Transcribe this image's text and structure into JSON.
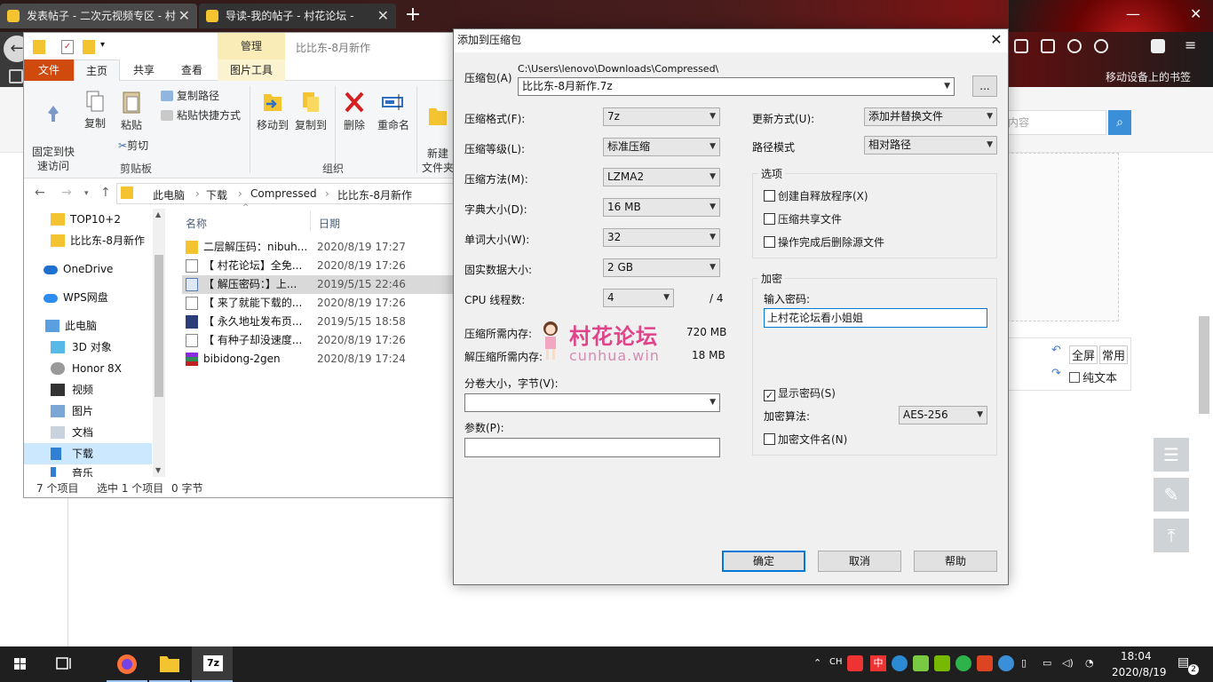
{
  "browser": {
    "tabs": [
      {
        "title": "发表帖子 - 二次元视频专区 - 村"
      },
      {
        "title": "导读-我的帖子 - 村花论坛 -"
      }
    ],
    "bookmarks_label": "移动设备上的书签",
    "search_placeholder": "内容",
    "editor": {
      "fullscreen": "全屏",
      "common": "常用",
      "plain_text": "纯文本"
    }
  },
  "explorer": {
    "title": "比比东-8月新作",
    "manage_tab": "管理",
    "tabs": {
      "file": "文件",
      "home": "主页",
      "share": "共享",
      "view": "查看",
      "picture_tools": "图片工具"
    },
    "ribbon": {
      "pin": "固定到快\n速访问",
      "copy": "复制",
      "paste": "粘贴",
      "copy_path": "复制路径",
      "paste_shortcut": "粘贴快捷方式",
      "cut": "剪切",
      "clipboard": "剪贴板",
      "move_to": "移动到",
      "copy_to": "复制到",
      "delete": "删除",
      "rename": "重命名",
      "new_folder": "新建\n文件夹",
      "organize": "组织"
    },
    "breadcrumb": [
      "此电脑",
      "下载",
      "Compressed",
      "比比东-8月新作"
    ],
    "nav_items": [
      {
        "label": "TOP10+2"
      },
      {
        "label": "比比东-8月新作"
      },
      {
        "label": "OneDrive"
      },
      {
        "label": "WPS网盘"
      },
      {
        "label": "此电脑"
      },
      {
        "label": "3D 对象"
      },
      {
        "label": "Honor 8X"
      },
      {
        "label": "视频"
      },
      {
        "label": "图片"
      },
      {
        "label": "文档"
      },
      {
        "label": "下载"
      },
      {
        "label": "音乐"
      }
    ],
    "columns": {
      "name": "名称",
      "date": "日期"
    },
    "files": [
      {
        "name": "二层解压码：nibuh...",
        "date": "2020/8/19 17:27"
      },
      {
        "name": "【 村花论坛】全免...",
        "date": "2020/8/19 17:26"
      },
      {
        "name": "【 解压密码：】上...",
        "date": "2019/5/15 22:46"
      },
      {
        "name": "【 来了就能下载的...",
        "date": "2020/8/19 17:26"
      },
      {
        "name": "【 永久地址发布页...",
        "date": "2019/5/15 18:58"
      },
      {
        "name": "【 有种子却没速度...",
        "date": "2020/8/19 17:26"
      },
      {
        "name": "bibidong-2gen",
        "date": "2020/8/19 17:24"
      }
    ],
    "status": {
      "count": "7 个项目",
      "selected": "选中 1 个项目",
      "size": "0 字节"
    }
  },
  "dialog": {
    "title": "添加到压缩包",
    "archive_label": "压缩包(A)",
    "archive_path": "C:\\Users\\lenovo\\Downloads\\Compressed\\",
    "archive_name": "比比东-8月新作.7z",
    "browse": "...",
    "format_label": "压缩格式(F):",
    "format": "7z",
    "level_label": "压缩等级(L):",
    "level": "标准压缩",
    "method_label": "压缩方法(M):",
    "method": "LZMA2",
    "dict_label": "字典大小(D):",
    "dict": "16 MB",
    "word_label": "单词大小(W):",
    "word": "32",
    "solid_label": "固实数据大小:",
    "solid": "2 GB",
    "threads_label": "CPU 线程数:",
    "threads": "4",
    "threads_total": "/ 4",
    "mem_comp_label": "压缩所需内存:",
    "mem_comp": "720 MB",
    "mem_decomp_label": "解压缩所需内存:",
    "mem_decomp": "18 MB",
    "split_label": "分卷大小，字节(V):",
    "split": "",
    "params_label": "参数(P):",
    "params": "",
    "update_label": "更新方式(U):",
    "update": "添加并替换文件",
    "path_label": "路径模式",
    "path_mode": "相对路径",
    "options_title": "选项",
    "opt_sfx": "创建自释放程序(X)",
    "opt_shared": "压缩共享文件",
    "opt_delete": "操作完成后删除源文件",
    "enc_title": "加密",
    "password_label": "输入密码:",
    "password": "上村花论坛看小姐姐",
    "show_password": "显示密码(S)",
    "enc_method_label": "加密算法:",
    "enc_method": "AES-256",
    "encrypt_names": "加密文件名(N)",
    "ok": "确定",
    "cancel": "取消",
    "help": "帮助",
    "watermark_main": "村花论坛",
    "watermark_sub": "cunhua.win"
  },
  "taskbar": {
    "time": "18:04",
    "date": "2020/8/19",
    "ime": "CH",
    "ime2": "中",
    "notifications": "2",
    "app_7z": "7z"
  }
}
